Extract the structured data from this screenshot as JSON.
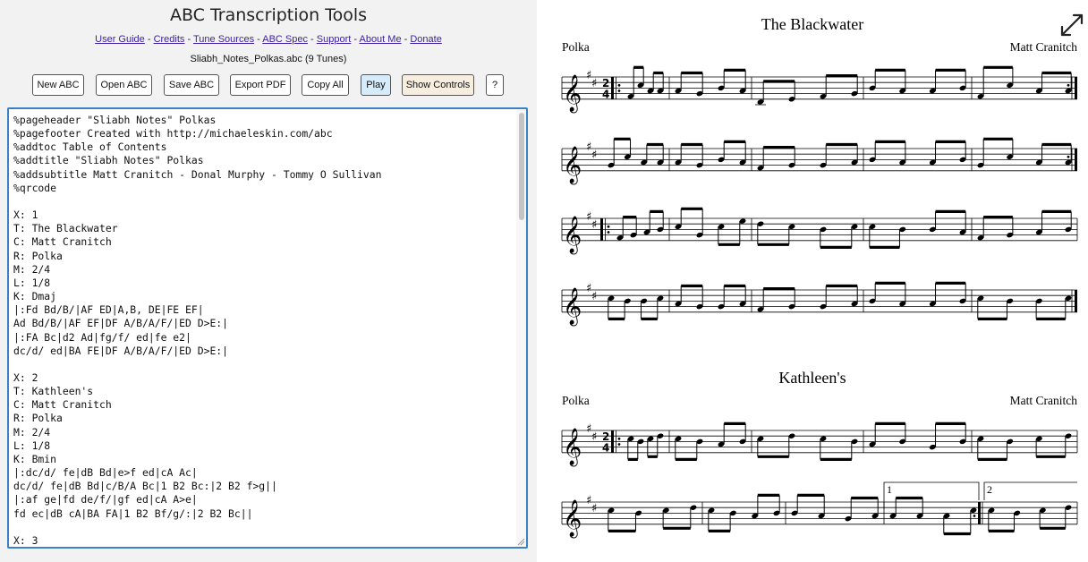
{
  "app": {
    "title": "ABC Transcription Tools"
  },
  "nav": [
    {
      "label": "User Guide"
    },
    {
      "label": "Credits"
    },
    {
      "label": "Tune Sources"
    },
    {
      "label": "ABC Spec"
    },
    {
      "label": "Support"
    },
    {
      "label": "About Me"
    },
    {
      "label": "Donate"
    }
  ],
  "file": {
    "label": "Sliabh_Notes_Polkas.abc (9 Tunes)"
  },
  "toolbar": {
    "new_abc": "New ABC",
    "open_abc": "Open ABC",
    "save_abc": "Save ABC",
    "export_pdf": "Export PDF",
    "copy_all": "Copy All",
    "play": "Play",
    "show_controls": "Show Controls",
    "help": "?"
  },
  "editor": {
    "lines": [
      "%pageheader \"Sliabh Notes\" Polkas",
      "%pagefooter Created with http://michaeleskin.com/abc",
      "%addtoc Table of Contents",
      "%addtitle \"Sliabh Notes\" Polkas",
      "%addsubtitle Matt Cranitch - Donal Murphy - Tommy O Sullivan",
      "%qrcode",
      "",
      "X: 1",
      "T: The Blackwater",
      "C: Matt Cranitch",
      "R: Polka",
      "M: 2/4",
      "L: 1/8",
      "K: Dmaj",
      "|:Fd Bd/B/|AF ED|A,B, DE|FE EF|",
      "Ad Bd/B/|AF EF|DF A/B/A/F/|ED D>E:|",
      "|:FA Bc|d2 Ad|fg/f/ ed|fe e2|",
      "dc/d/ ed|BA FE|DF A/B/A/F/|ED D>E:|",
      "",
      "X: 2",
      "T: Kathleen's",
      "C: Matt Cranitch",
      "R: Polka",
      "M: 2/4",
      "L: 1/8",
      "K: Bmin",
      "|:dc/d/ fe|dB Bd|e>f ed|cA Ac|",
      "dc/d/ fe|dB Bd|c/B/A Bc|1 B2 Bc:|2 B2 f>g||",
      "|:af ge|fd de/f/|gf ed|cA A>e|",
      "fd ec|dB cA|BA FA|1 B2 Bf/g/:|2 B2 Bc||",
      "",
      "X: 3"
    ]
  },
  "score": {
    "tunes": [
      {
        "title": "The Blackwater",
        "rhythm": "Polka",
        "composer": "Matt Cranitch",
        "meter_top": "2",
        "meter_bottom": "4"
      },
      {
        "title": "Kathleen's",
        "rhythm": "Polka",
        "composer": "Matt Cranitch",
        "meter_top": "2",
        "meter_bottom": "4"
      }
    ],
    "endings": [
      "1",
      "2"
    ]
  },
  "icons": {
    "expand": "expand-arrows-icon"
  },
  "colors": {
    "editor_border": "#3b82c4",
    "play_bg": "#d6ecfa",
    "controls_bg": "#f7eee0",
    "link": "#3b1f9e"
  }
}
